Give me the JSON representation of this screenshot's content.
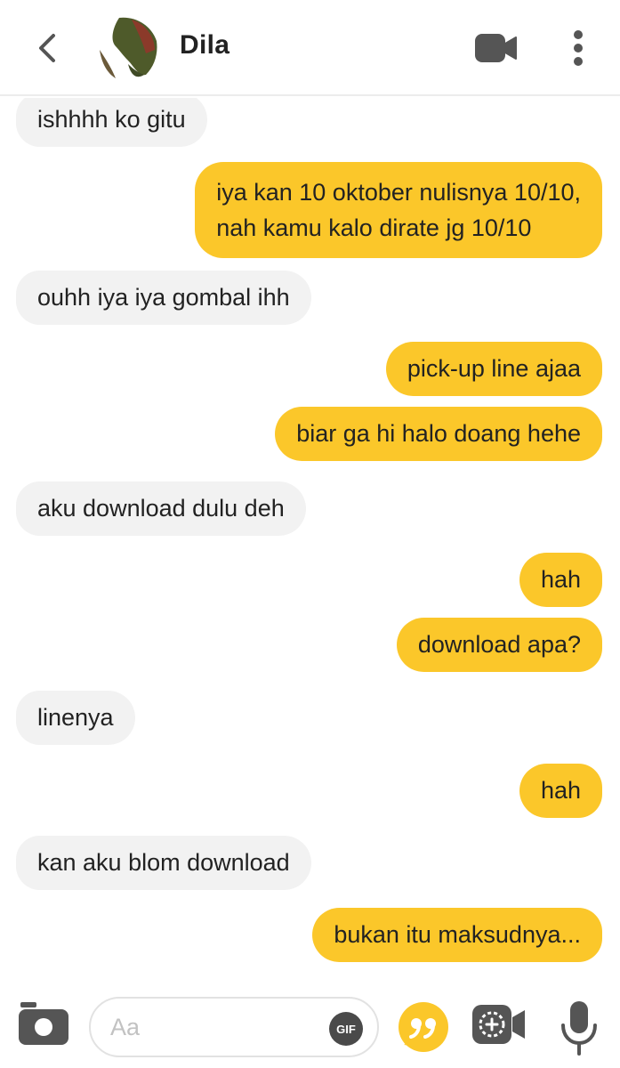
{
  "header": {
    "contact_name": "Dila",
    "icons": {
      "back": "back-chevron-icon",
      "video": "video-camera-icon",
      "more": "more-vertical-icon"
    }
  },
  "messages": [
    {
      "side": "in",
      "text": "ishhhh ko gitu"
    },
    {
      "side": "out",
      "text": "iya kan 10 oktober nulisnya 10/10,\nnah kamu kalo dirate jg 10/10"
    },
    {
      "side": "in",
      "text": "ouhh iya iya gombal ihh"
    },
    {
      "side": "out",
      "text": "pick-up line ajaa"
    },
    {
      "side": "out",
      "text": "biar ga hi halo doang hehe"
    },
    {
      "side": "in",
      "text": "aku download dulu deh"
    },
    {
      "side": "out",
      "text": "hah"
    },
    {
      "side": "out",
      "text": "download apa?"
    },
    {
      "side": "in",
      "text": "linenya"
    },
    {
      "side": "out",
      "text": "hah"
    },
    {
      "side": "in",
      "text": "kan aku blom download"
    },
    {
      "side": "out",
      "text": "bukan itu maksudnya..."
    }
  ],
  "composer": {
    "placeholder": "Aa",
    "gif_label": "GIF",
    "icons": {
      "camera": "camera-icon",
      "quote": "quote-icon",
      "sticker": "sticker-video-icon",
      "mic": "microphone-icon"
    }
  },
  "colors": {
    "outgoing_bubble": "#fbc72a",
    "incoming_bubble": "#f2f2f2",
    "icon_gray": "#555555"
  }
}
